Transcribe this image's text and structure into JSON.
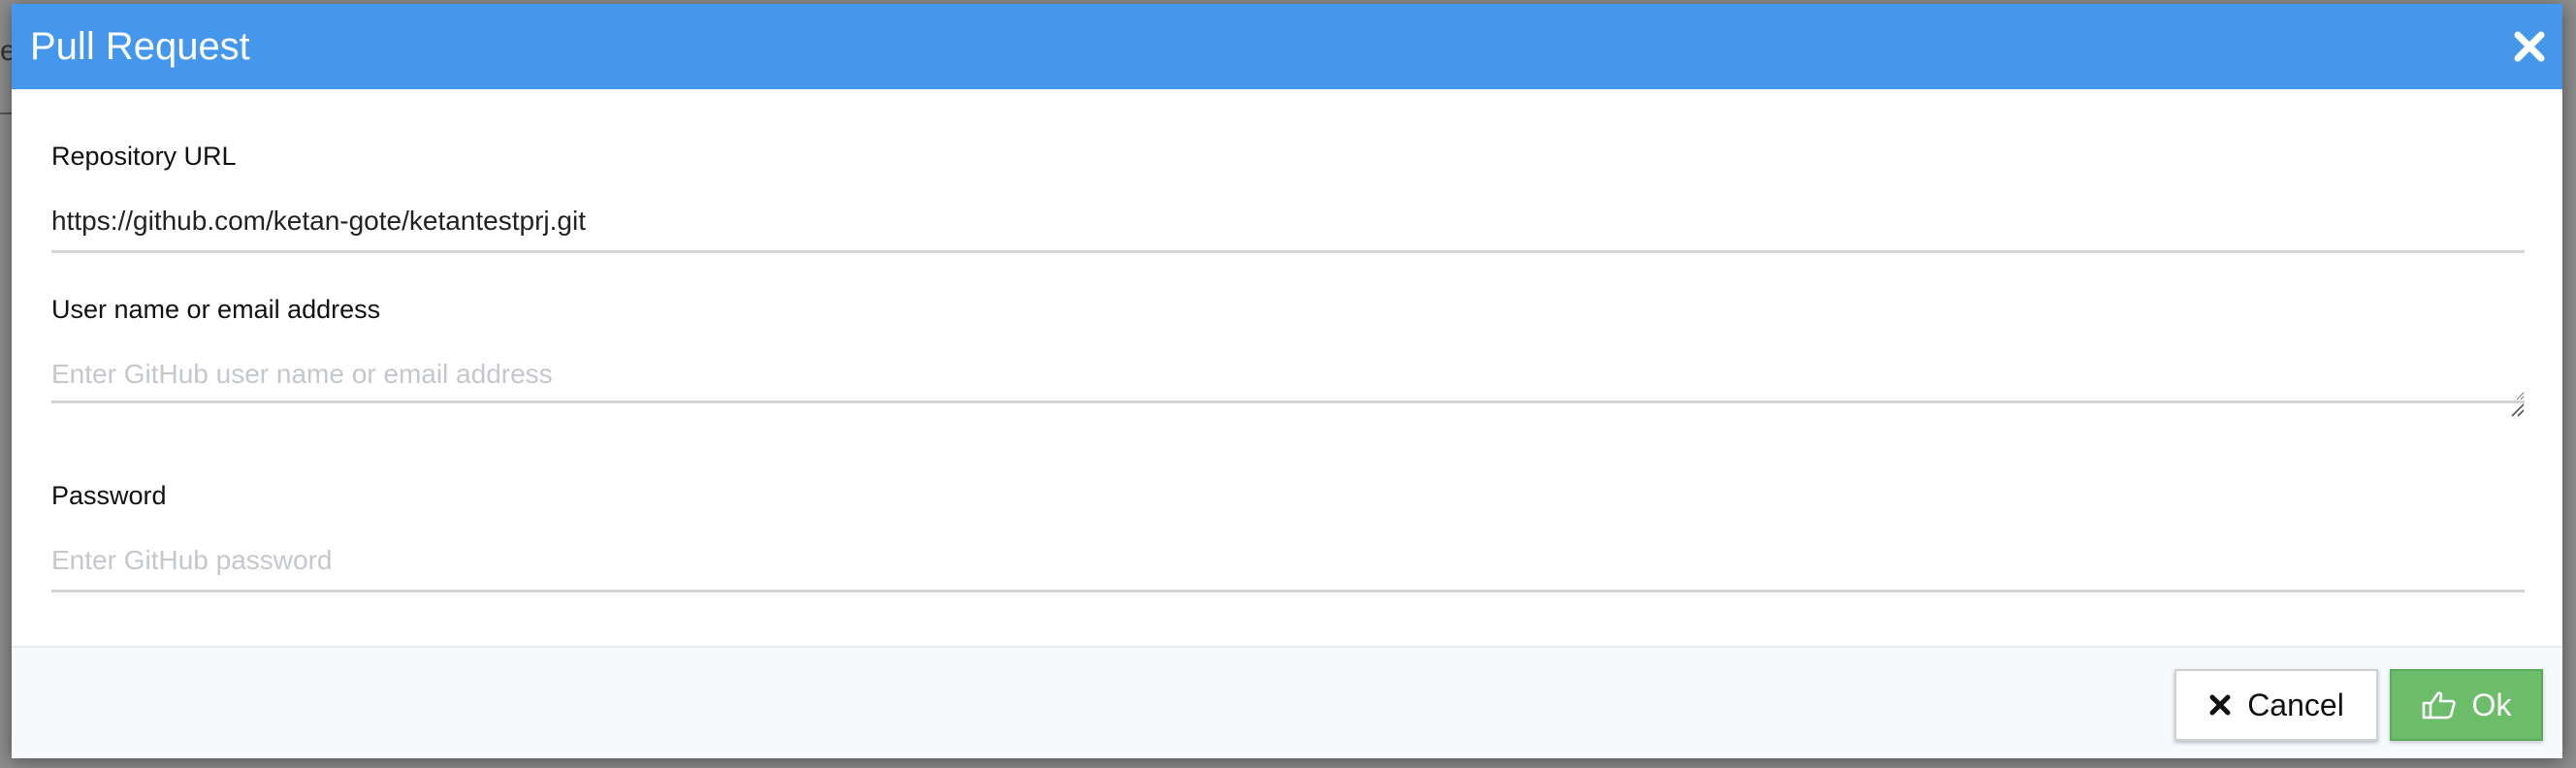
{
  "background": {
    "fragment_text": "e"
  },
  "modal": {
    "title": "Pull Request",
    "close_icon": "close-icon",
    "header_color": "#4497ea"
  },
  "form": {
    "repository": {
      "label": "Repository URL",
      "value": "https://github.com/ketan-gote/ketantestprj.git"
    },
    "username": {
      "label": "User name or email address",
      "value": "",
      "placeholder": "Enter GitHub user name or email address"
    },
    "password": {
      "label": "Password",
      "value": "",
      "placeholder": "Enter GitHub password"
    }
  },
  "footer": {
    "cancel_label": "Cancel",
    "cancel_icon": "times-icon",
    "ok_label": "Ok",
    "ok_icon": "thumbs-up-icon",
    "ok_color": "#6cbd6a"
  }
}
